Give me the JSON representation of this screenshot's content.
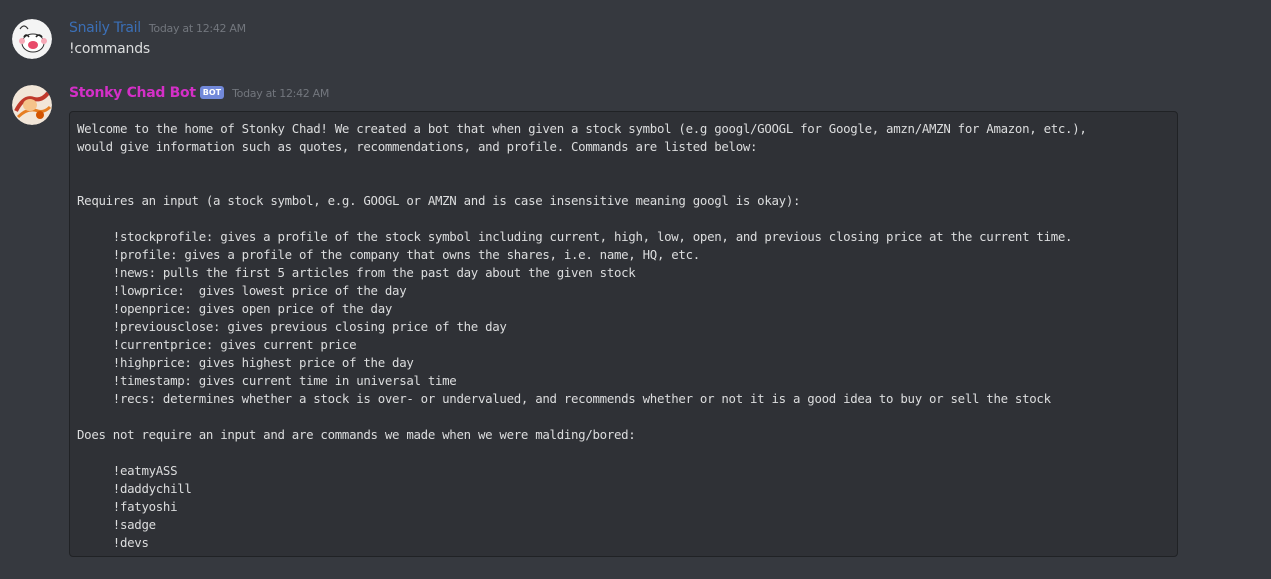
{
  "messages": [
    {
      "username": "Snaily Trail",
      "timestamp": "Today at 12:42 AM",
      "content": "!commands",
      "avatar": "snail-avatar"
    },
    {
      "username": "Stonky Chad Bot",
      "bot_tag": "BOT",
      "timestamp": "Today at 12:42 AM",
      "avatar": "stonky-avatar",
      "code_block": "Welcome to the home of Stonky Chad! We created a bot that when given a stock symbol (e.g googl/GOOGL for Google, amzn/AMZN for Amazon, etc.),\nwould give information such as quotes, recommendations, and profile. Commands are listed below:\n\n\nRequires an input (a stock symbol, e.g. GOOGL or AMZN and is case insensitive meaning googl is okay):\n\n     !stockprofile: gives a profile of the stock symbol including current, high, low, open, and previous closing price at the current time.\n     !profile: gives a profile of the company that owns the shares, i.e. name, HQ, etc.\n     !news: pulls the first 5 articles from the past day about the given stock\n     !lowprice:  gives lowest price of the day\n     !openprice: gives open price of the day\n     !previousclose: gives previous closing price of the day\n     !currentprice: gives current price\n     !highprice: gives highest price of the day\n     !timestamp: gives current time in universal time\n     !recs: determines whether a stock is over- or undervalued, and recommends whether or not it is a good idea to buy or sell the stock\n\nDoes not require an input and are commands we made when we were malding/bored:\n\n     !eatmyASS\n     !daddychill\n     !fatyoshi\n     !sadge\n     !devs"
    }
  ],
  "colors": {
    "background": "#36393f",
    "codeblock_bg": "#2f3136",
    "snaily_name": "#3b6fb6",
    "stonky_name": "#d42fc7",
    "bot_tag": "#7289da",
    "text": "#dcddde",
    "timestamp": "#72767d"
  }
}
